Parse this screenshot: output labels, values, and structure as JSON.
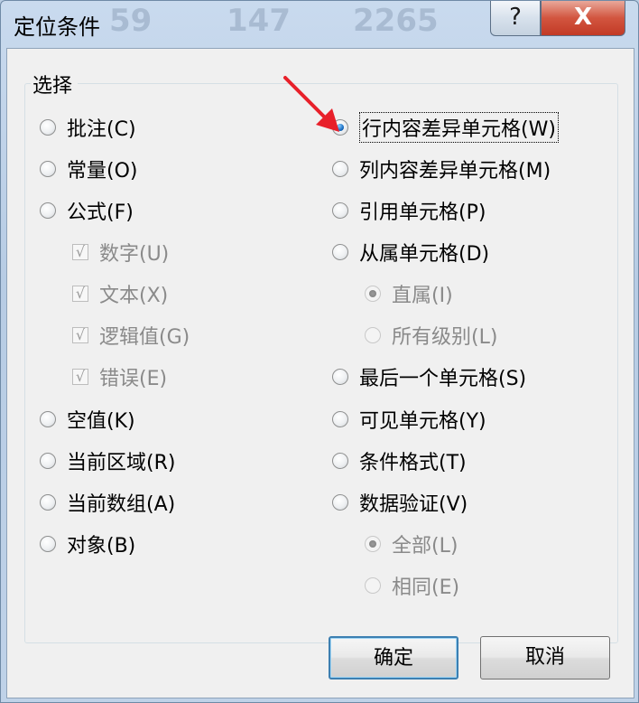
{
  "window": {
    "title": "定位条件",
    "help_label": "?",
    "close_label": "X"
  },
  "background_ghost": [
    "59",
    "147",
    "2265"
  ],
  "group": {
    "label": "选择"
  },
  "left_options": [
    {
      "label": "批注(C)",
      "type": "radio",
      "checked": false,
      "disabled": false
    },
    {
      "label": "常量(O)",
      "type": "radio",
      "checked": false,
      "disabled": false
    },
    {
      "label": "公式(F)",
      "type": "radio",
      "checked": false,
      "disabled": false
    },
    {
      "label": "数字(U)",
      "type": "checkbox",
      "checked": true,
      "disabled": true
    },
    {
      "label": "文本(X)",
      "type": "checkbox",
      "checked": true,
      "disabled": true
    },
    {
      "label": "逻辑值(G)",
      "type": "checkbox",
      "checked": true,
      "disabled": true
    },
    {
      "label": "错误(E)",
      "type": "checkbox",
      "checked": true,
      "disabled": true
    },
    {
      "label": "空值(K)",
      "type": "radio",
      "checked": false,
      "disabled": false
    },
    {
      "label": "当前区域(R)",
      "type": "radio",
      "checked": false,
      "disabled": false
    },
    {
      "label": "当前数组(A)",
      "type": "radio",
      "checked": false,
      "disabled": false
    },
    {
      "label": "对象(B)",
      "type": "radio",
      "checked": false,
      "disabled": false
    }
  ],
  "right_options": [
    {
      "label": "行内容差异单元格(W)",
      "type": "radio",
      "checked": true,
      "disabled": false
    },
    {
      "label": "列内容差异单元格(M)",
      "type": "radio",
      "checked": false,
      "disabled": false
    },
    {
      "label": "引用单元格(P)",
      "type": "radio",
      "checked": false,
      "disabled": false
    },
    {
      "label": "从属单元格(D)",
      "type": "radio",
      "checked": false,
      "disabled": false
    },
    {
      "label": "直属(I)",
      "type": "radio",
      "checked": true,
      "disabled": true
    },
    {
      "label": "所有级别(L)",
      "type": "radio",
      "checked": false,
      "disabled": true
    },
    {
      "label": "最后一个单元格(S)",
      "type": "radio",
      "checked": false,
      "disabled": false
    },
    {
      "label": "可见单元格(Y)",
      "type": "radio",
      "checked": false,
      "disabled": false
    },
    {
      "label": "条件格式(T)",
      "type": "radio",
      "checked": false,
      "disabled": false
    },
    {
      "label": "数据验证(V)",
      "type": "radio",
      "checked": false,
      "disabled": false
    },
    {
      "label": "全部(L)",
      "type": "radio",
      "checked": true,
      "disabled": true
    },
    {
      "label": "相同(E)",
      "type": "radio",
      "checked": false,
      "disabled": true
    }
  ],
  "buttons": {
    "ok": "确定",
    "cancel": "取消"
  },
  "colors": {
    "arrow": "#e8202a",
    "accent": "#3c7fb1",
    "close": "#c23a26"
  }
}
